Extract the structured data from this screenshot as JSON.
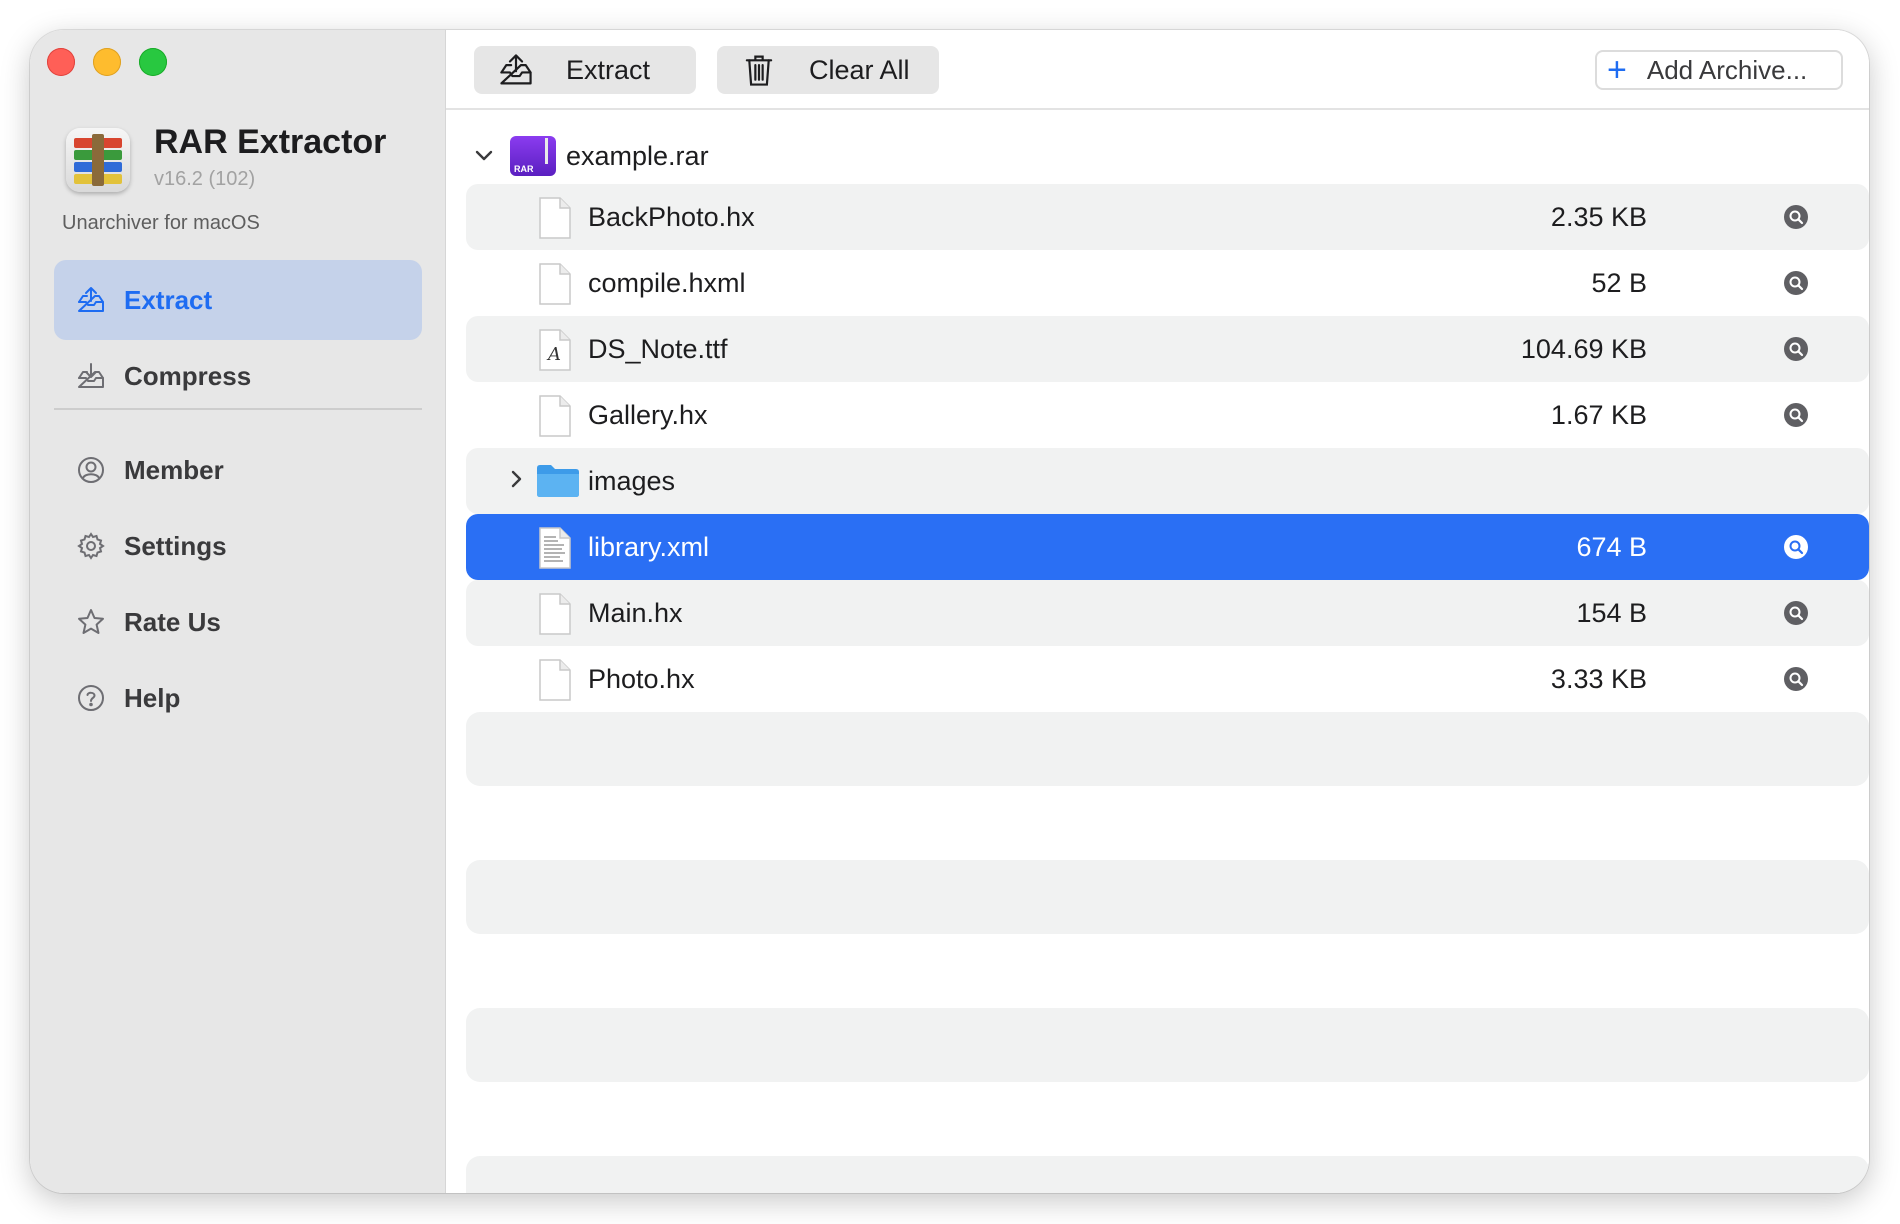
{
  "app": {
    "name": "RAR Extractor",
    "version": "v16.2 (102)",
    "tagline": "Unarchiver for macOS"
  },
  "sidebar": {
    "items": [
      {
        "label": "Extract",
        "icon": "tray-upload-icon",
        "active": true
      },
      {
        "label": "Compress",
        "icon": "tray-download-icon",
        "active": false
      },
      {
        "label": "Member",
        "icon": "person-circle-icon",
        "active": false
      },
      {
        "label": "Settings",
        "icon": "gear-icon",
        "active": false
      },
      {
        "label": "Rate Us",
        "icon": "star-icon",
        "active": false
      },
      {
        "label": "Help",
        "icon": "question-circle-icon",
        "active": false
      }
    ]
  },
  "toolbar": {
    "extract_label": "Extract",
    "clear_label": "Clear All",
    "add_label": "Add Archive..."
  },
  "archive": {
    "name": "example.rar",
    "badge": "RAR",
    "files": [
      {
        "name": "BackPhoto.hx",
        "size": "2.35 KB",
        "icon": "document-icon"
      },
      {
        "name": "compile.hxml",
        "size": "52 B",
        "icon": "document-icon"
      },
      {
        "name": "DS_Note.ttf",
        "size": "104.69 KB",
        "icon": "font-file-icon"
      },
      {
        "name": "Gallery.hx",
        "size": "1.67 KB",
        "icon": "document-icon"
      },
      {
        "name": "images",
        "size": "",
        "icon": "folder-icon"
      },
      {
        "name": "library.xml",
        "size": "674 B",
        "icon": "xml-file-icon",
        "selected": true
      },
      {
        "name": "Main.hx",
        "size": "154 B",
        "icon": "document-icon"
      },
      {
        "name": "Photo.hx",
        "size": "3.33 KB",
        "icon": "document-icon"
      }
    ]
  },
  "colors": {
    "accent": "#1e6cf2",
    "selection": "#2a6ff4",
    "sidebar_bg": "#e7e7e7",
    "active_item_bg": "#c5d2ea",
    "stripe": "#f1f2f2"
  }
}
